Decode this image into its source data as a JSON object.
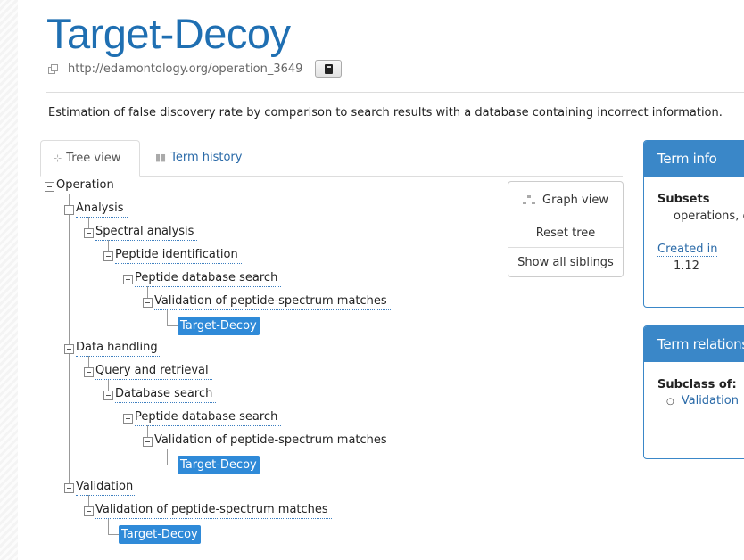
{
  "title": "Target-Decoy",
  "uri": "http://edamontology.org/operation_3649",
  "description": "Estimation of false discovery rate by comparison to search results with a database containing incorrect information.",
  "tabs": [
    {
      "label": "Tree view",
      "icon": "tree-icon",
      "active": true
    },
    {
      "label": "Term history",
      "icon": "bar-chart-icon",
      "active": false
    }
  ],
  "tree": {
    "operation": "Operation",
    "analysis": "Analysis",
    "spectral_analysis": "Spectral analysis",
    "peptide_identification": "Peptide identification",
    "peptide_db_search_1": "Peptide database search",
    "validation_psm_1": "Validation of peptide-spectrum matches",
    "target_decoy_1": "Target-Decoy",
    "data_handling": "Data handling",
    "query_retrieval": "Query and retrieval",
    "database_search": "Database search",
    "peptide_db_search_2": "Peptide database search",
    "validation_psm_2": "Validation of peptide-spectrum matches",
    "target_decoy_2": "Target-Decoy",
    "validation": "Validation",
    "validation_psm_3": "Validation of peptide-spectrum matches",
    "target_decoy_3": "Target-Decoy"
  },
  "tree_buttons": {
    "graph_view": "Graph view",
    "reset_tree": "Reset tree",
    "show_siblings": "Show all siblings"
  },
  "term_info": {
    "heading": "Term info",
    "subsets_label": "Subsets",
    "subsets_value": "operations, e",
    "created_label": "Created in",
    "created_value": "1.12"
  },
  "term_relations": {
    "heading": "Term relations",
    "subclass_label": "Subclass of:",
    "subclass_item": "Validation"
  },
  "colors": {
    "accent": "#1f6fb2",
    "highlight": "#2f8ad8",
    "panel": "#3a87c8"
  }
}
